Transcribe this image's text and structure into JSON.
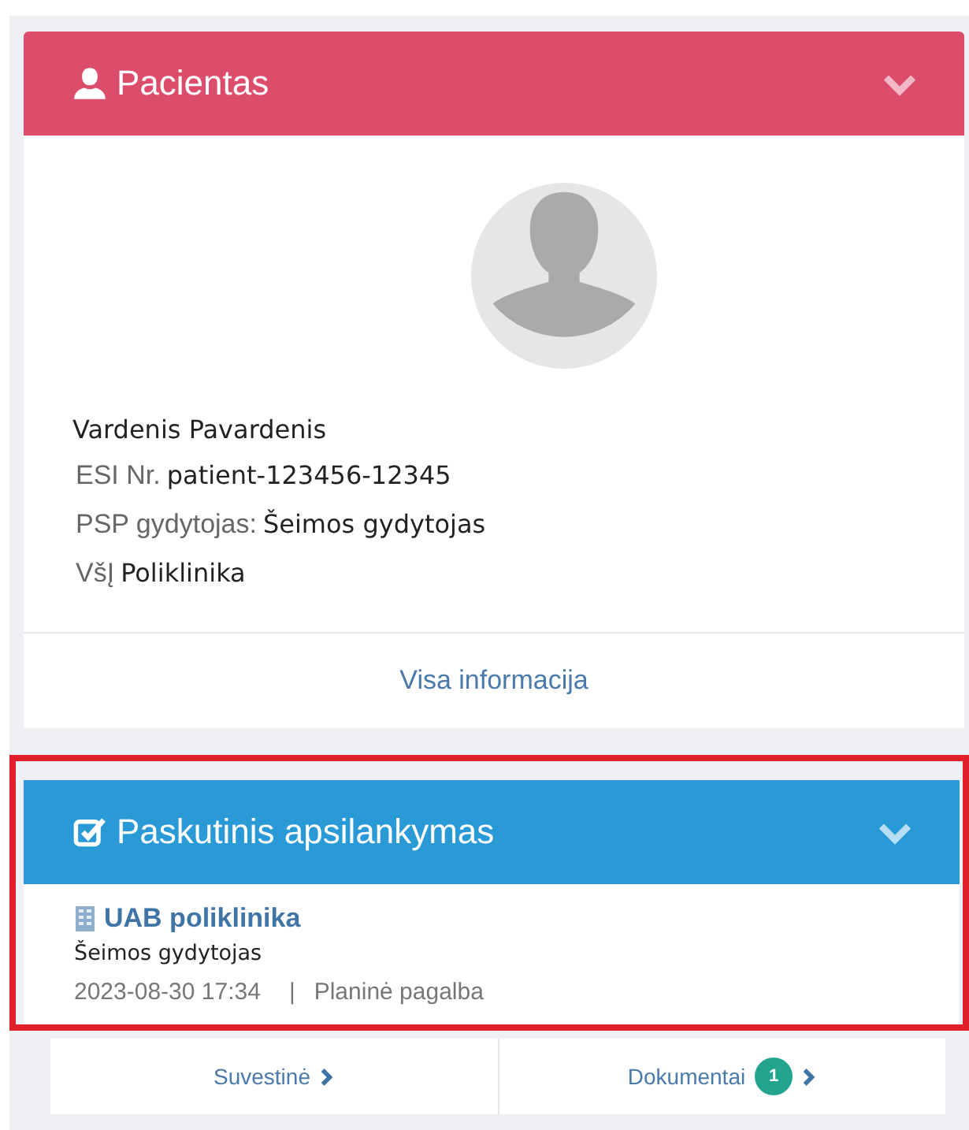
{
  "patient_panel": {
    "title": "Pacientas",
    "name": "Vardenis Pavardenis",
    "fields": [
      {
        "label": "ESI Nr.",
        "value": "patient-123456-12345"
      },
      {
        "label": "PSP gydytojas:",
        "value": "Šeimos gydytojas"
      },
      {
        "label": "VšĮ",
        "value": "Poliklinika"
      }
    ],
    "link": "Visa informacija"
  },
  "visit_panel": {
    "title": "Paskutinis apsilankymas",
    "highlighted": true,
    "institution": "UAB poliklinika",
    "specialty": "Šeimos gydytojas",
    "datetime": "2023-08-30 17:34",
    "separator": "|",
    "care_type": "Planinė pagalba"
  },
  "footer": [
    {
      "label": "Suvestinė"
    },
    {
      "label": "Dokumentai",
      "badge": "1"
    }
  ]
}
